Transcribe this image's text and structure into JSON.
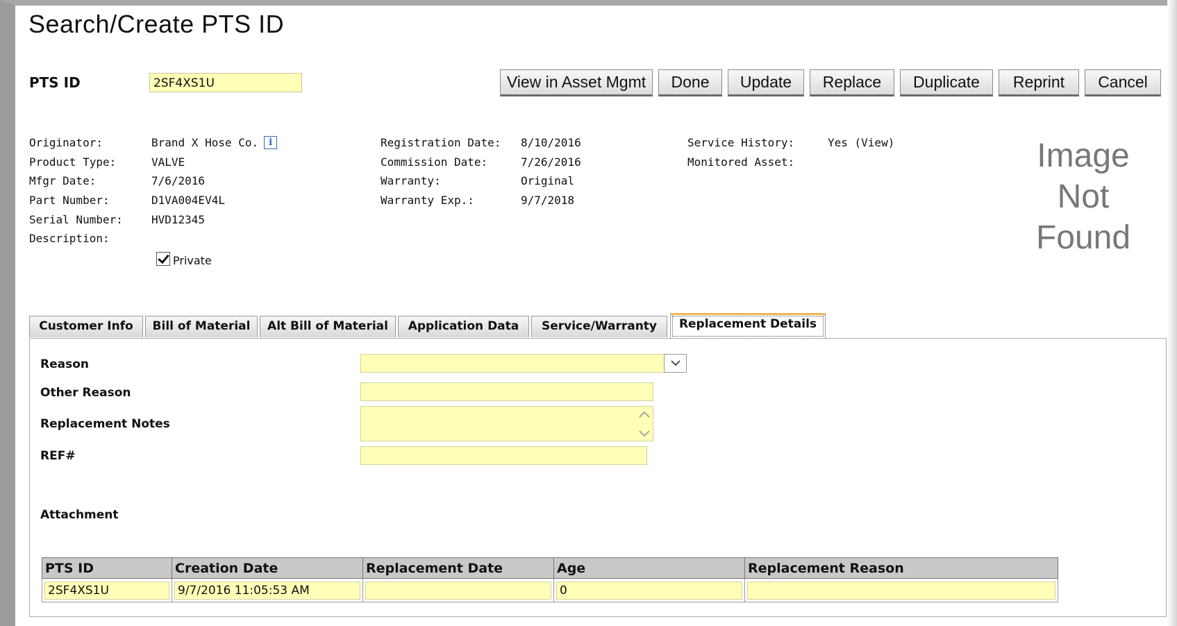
{
  "page": {
    "title": "Search/Create PTS ID"
  },
  "pts": {
    "label": "PTS ID",
    "value": "2SF4XS1U"
  },
  "toolbar": {
    "buttons": [
      {
        "label": "View in Asset Mgmt"
      },
      {
        "label": "Done"
      },
      {
        "label": "Update"
      },
      {
        "label": "Replace"
      },
      {
        "label": "Duplicate"
      },
      {
        "label": "Reprint"
      },
      {
        "label": "Cancel"
      }
    ]
  },
  "info": {
    "col1": [
      {
        "label": "Originator:",
        "value": "Brand X Hose Co."
      },
      {
        "label": "Product Type:",
        "value": "VALVE"
      },
      {
        "label": "Mfgr Date:",
        "value": "7/6/2016"
      },
      {
        "label": "Part Number:",
        "value": "D1VA004EV4L"
      },
      {
        "label": "Serial Number:",
        "value": "HVD12345"
      },
      {
        "label": "Description:",
        "value": ""
      }
    ],
    "col2": [
      {
        "label": "Registration Date:",
        "value": "8/10/2016"
      },
      {
        "label": "Commission Date:",
        "value": "7/26/2016"
      },
      {
        "label": "Warranty:",
        "value": "Original"
      },
      {
        "label": "Warranty Exp.:",
        "value": "9/7/2018"
      }
    ],
    "col3": [
      {
        "label": "Service History:",
        "value": "Yes (View)"
      },
      {
        "label": "Monitored Asset:",
        "value": ""
      }
    ],
    "private_label": "Private",
    "private_checked": true
  },
  "image": {
    "lines": [
      "Image",
      "Not",
      "Found"
    ]
  },
  "tabs": [
    {
      "label": "Customer Info"
    },
    {
      "label": "Bill of Material"
    },
    {
      "label": "Alt Bill of Material"
    },
    {
      "label": "Application Data"
    },
    {
      "label": "Service/Warranty"
    },
    {
      "label": "Replacement Details",
      "active": true
    }
  ],
  "form": {
    "reason_label": "Reason",
    "reason_value": "",
    "other_reason_label": "Other Reason",
    "other_reason_value": "",
    "notes_label": "Replacement Notes",
    "notes_value": "",
    "ref_label": "REF#",
    "ref_value": "",
    "attachment_label": "Attachment"
  },
  "grid": {
    "headers": [
      "PTS ID",
      "Creation Date",
      "Replacement Date",
      "Age",
      "Replacement Reason"
    ],
    "row": [
      "2SF4XS1U",
      "9/7/2016 11:05:53 AM",
      "",
      "0",
      ""
    ]
  },
  "colors": {
    "field": "#ffffb7",
    "tab_accent": "#f2b64f",
    "header_bg": "#c9c9c9"
  }
}
